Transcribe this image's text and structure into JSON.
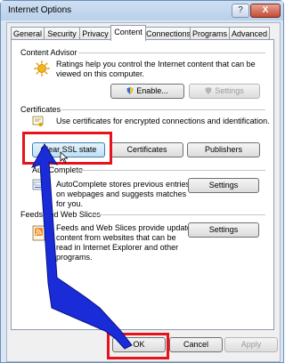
{
  "window": {
    "title": "Internet Options",
    "help_glyph": "?",
    "close_glyph": "X"
  },
  "tabs": [
    {
      "label": "General"
    },
    {
      "label": "Security"
    },
    {
      "label": "Privacy"
    },
    {
      "label": "Content"
    },
    {
      "label": "Connections"
    },
    {
      "label": "Programs"
    },
    {
      "label": "Advanced"
    }
  ],
  "active_tab": "Content",
  "content_advisor": {
    "title": "Content Advisor",
    "desc_line1": "Ratings help you control the Internet content that can be",
    "desc_line2": "viewed on this computer.",
    "enable_label": "Enable...",
    "settings_label": "Settings"
  },
  "certificates": {
    "title": "Certificates",
    "desc": "Use certificates for encrypted connections and identification.",
    "clear_ssl_label": "Clear SSL state",
    "certificates_label": "Certificates",
    "publishers_label": "Publishers"
  },
  "autocomplete": {
    "title": "AutoComplete",
    "title_visible": "AutoComplete",
    "desc_line1": "AutoComplete stores previous entries",
    "desc_line2": "on webpages and suggests matches",
    "desc_line3": "for you.",
    "settings_label": "Settings"
  },
  "feeds": {
    "title": "Feeds and Web Slices",
    "desc_line1": "Feeds and Web Slices provide updated",
    "desc_line2": "content from websites that can be",
    "desc_line3": "read in Internet Explorer and other",
    "desc_line4": "programs.",
    "settings_label": "Settings"
  },
  "footer": {
    "ok_label": "OK",
    "cancel_label": "Cancel",
    "apply_label": "Apply"
  },
  "colors": {
    "highlight_box": "#e8121b",
    "arrow": "#1a2bd8"
  }
}
